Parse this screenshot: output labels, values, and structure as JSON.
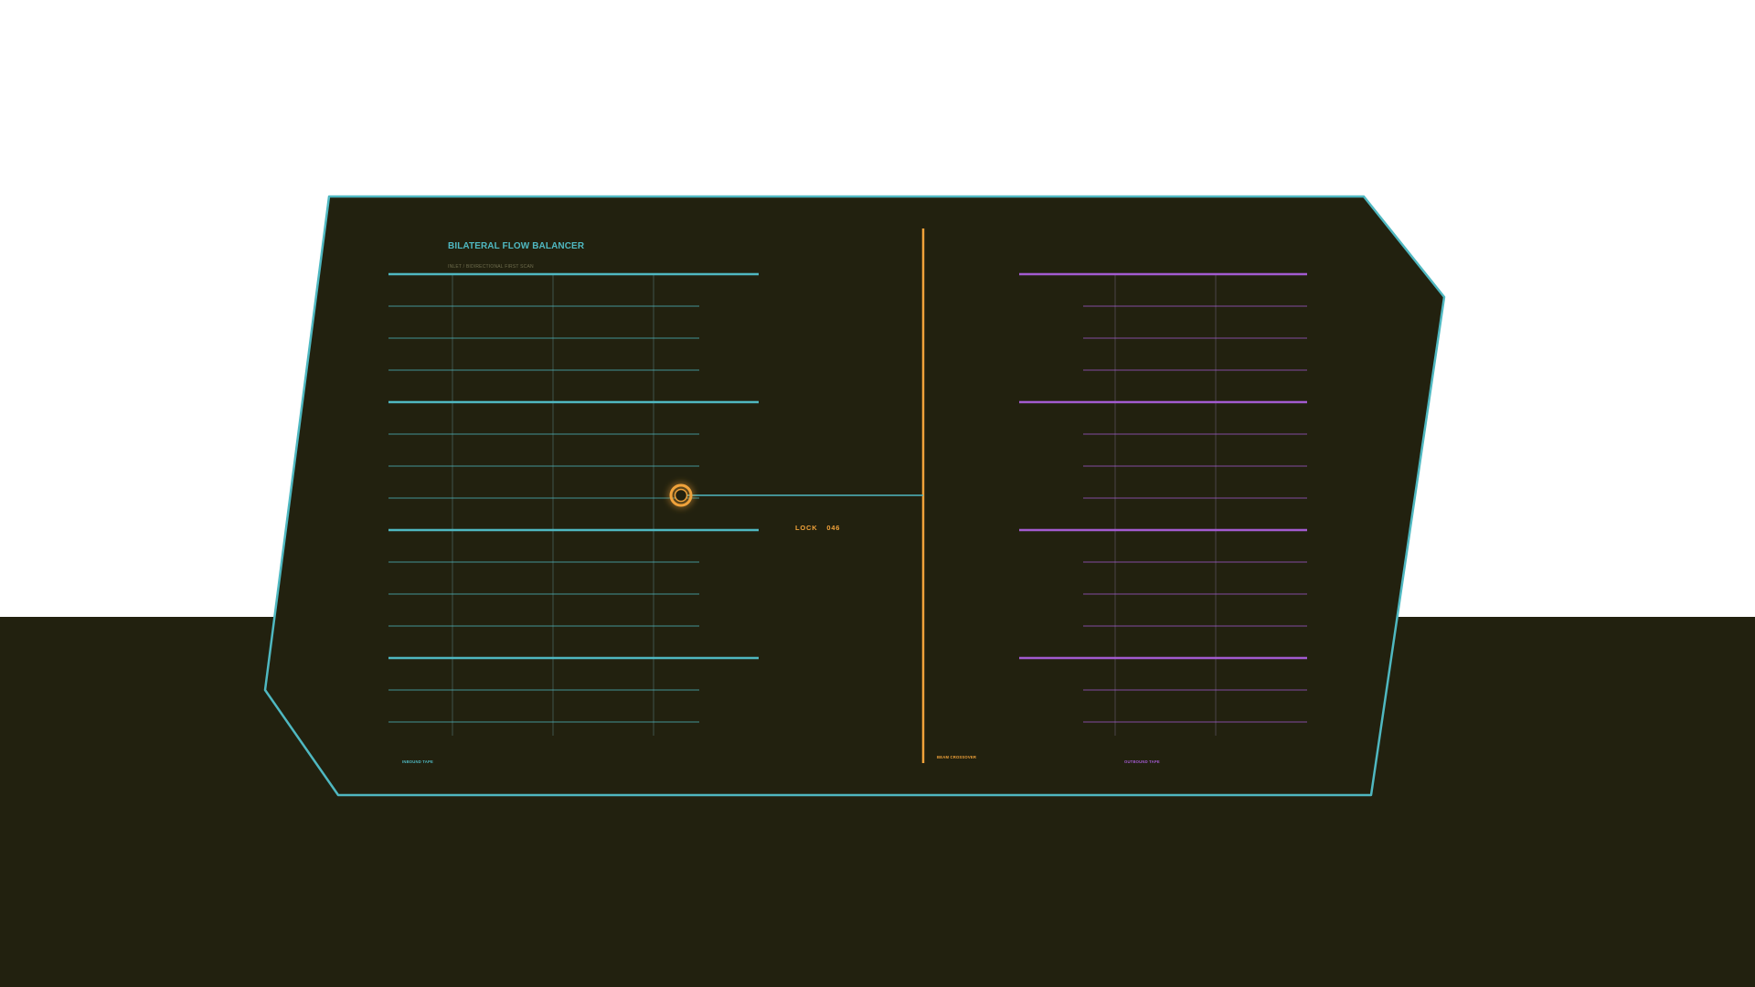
{
  "app": {
    "title": "BILATERAL FLOW BALANCER",
    "subtitle": "INLET / BIDIRECTIONAL FIRST SCAN"
  },
  "lock": {
    "label": "LOCK",
    "value": "046"
  },
  "labels": {
    "left": "INBOUND TAPE",
    "center": "BEAM CROSSOVER",
    "right": "OUTBOUND TAPE"
  },
  "colors": {
    "background": "#22210f",
    "frame": "#4fb8c1",
    "inbound": "#4fb8c1",
    "outbound": "#a35bd0",
    "crossover": "#f0a23a",
    "marker": "#d8f0cb"
  },
  "icons": {
    "lock_indicator": "ring-target-icon"
  }
}
